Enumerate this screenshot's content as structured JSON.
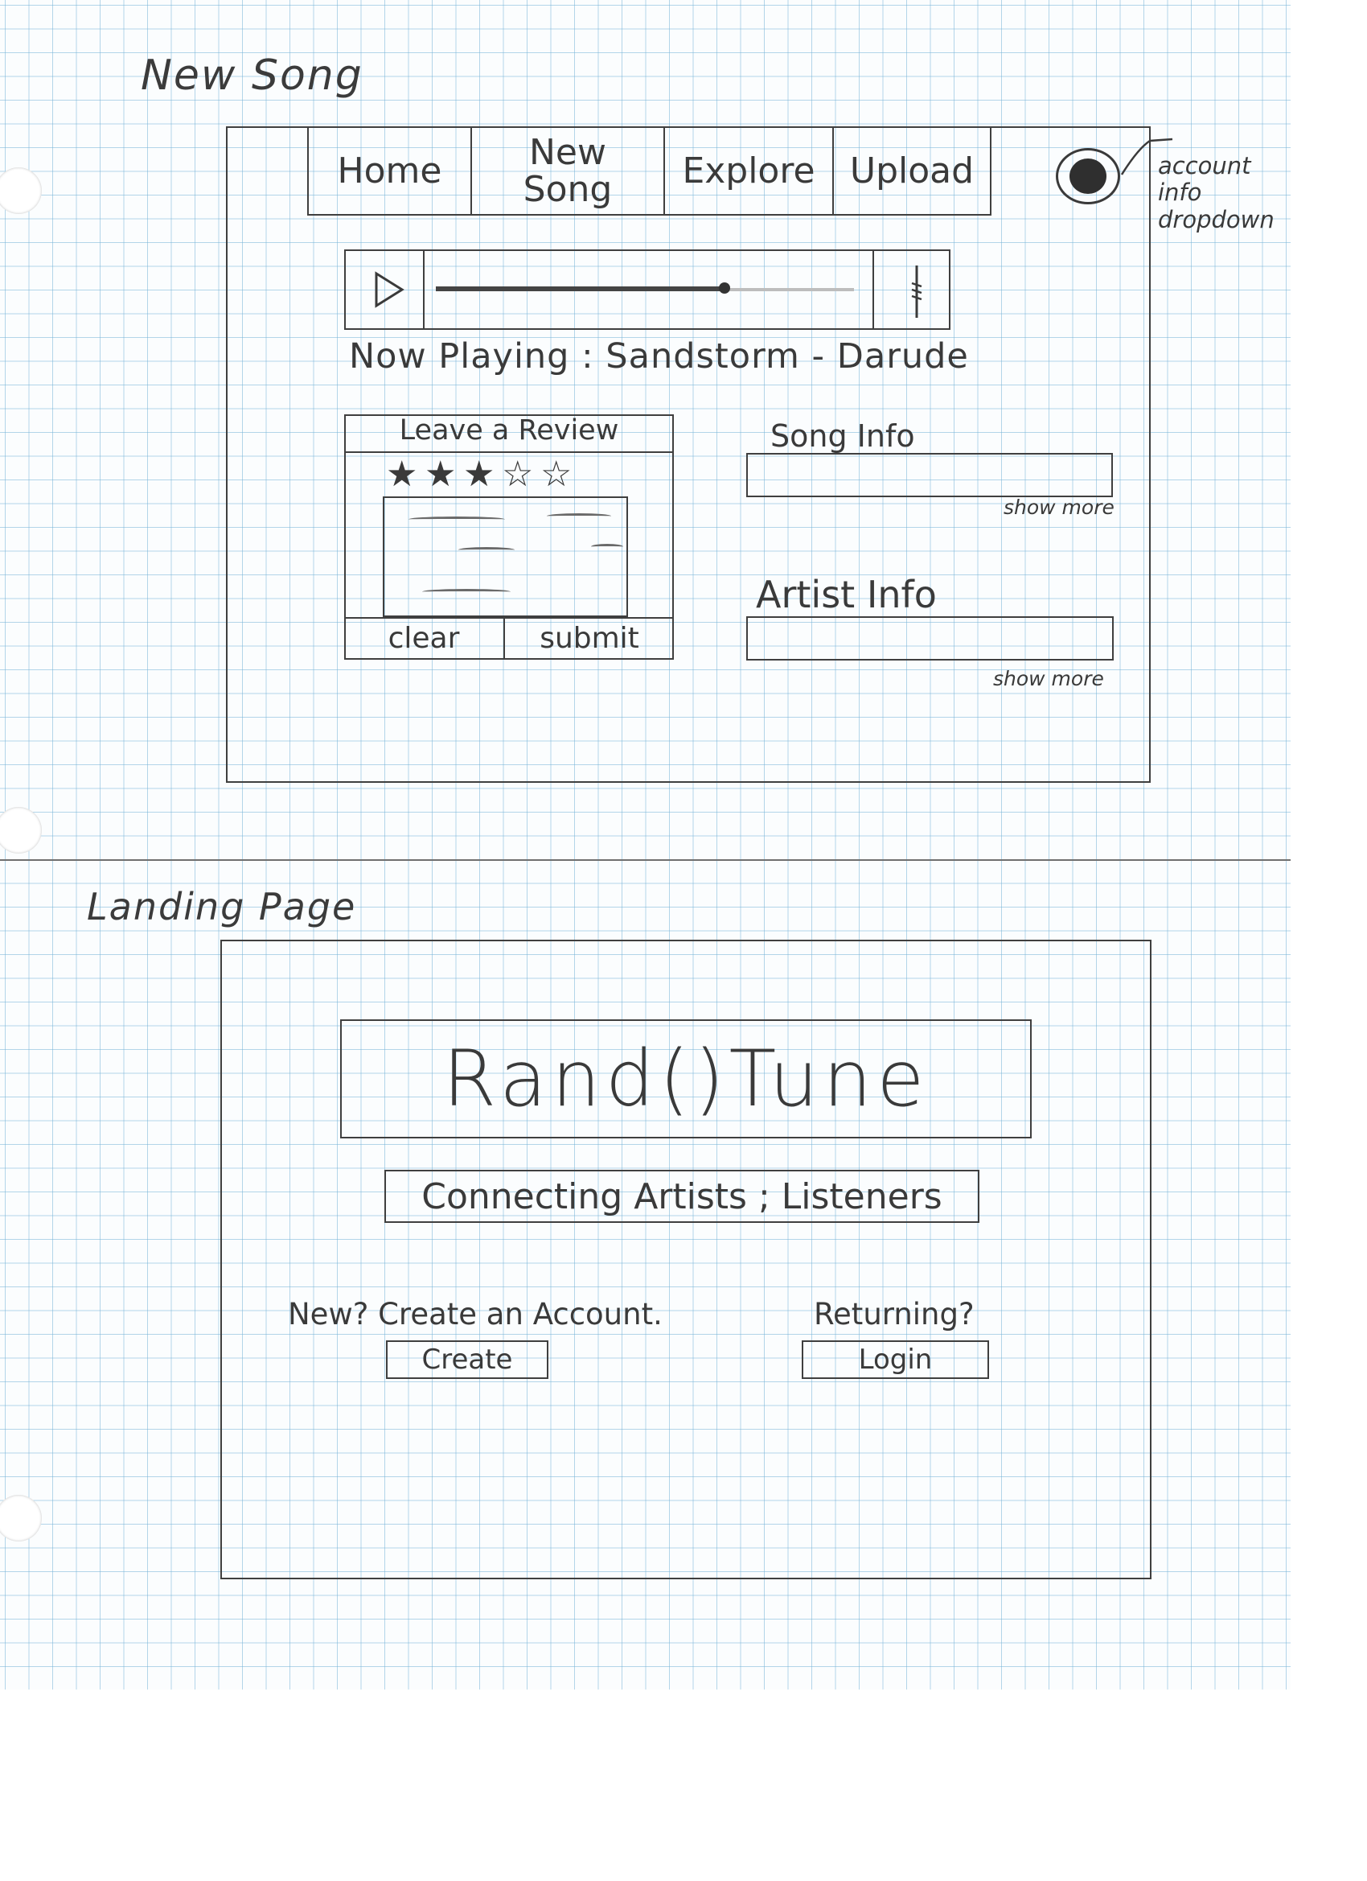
{
  "sections": {
    "new_song_title": "New Song",
    "landing_title": "Landing Page"
  },
  "new_song": {
    "nav": {
      "home": "Home",
      "new_song": "New Song",
      "explore": "Explore",
      "upload": "Upload"
    },
    "account_annotation": "account info dropdown",
    "player": {
      "play_icon": "play-icon",
      "progress": 0.69,
      "volume_icon": "volume-slider-icon"
    },
    "now_playing": "Now Playing : Sandstorm - Darude",
    "review": {
      "title": "Leave a Review",
      "rating": 3,
      "max_rating": 5,
      "filled_star": "★",
      "empty_star": "☆",
      "clear_label": "clear",
      "submit_label": "submit"
    },
    "song_info": {
      "title": "Song Info",
      "show_more": "show more"
    },
    "artist_info": {
      "title": "Artist Info",
      "show_more": "show more"
    }
  },
  "landing": {
    "logo": "Rand()Tune",
    "tagline": "Connecting Artists ; Listeners",
    "new_prompt": "New? Create an Account.",
    "create_label": "Create",
    "returning_prompt": "Returning?",
    "login_label": "Login"
  },
  "colors": {
    "pencil": "#3f3f3f",
    "grid": "#78b4d7",
    "paper": "#fbfdfe"
  }
}
